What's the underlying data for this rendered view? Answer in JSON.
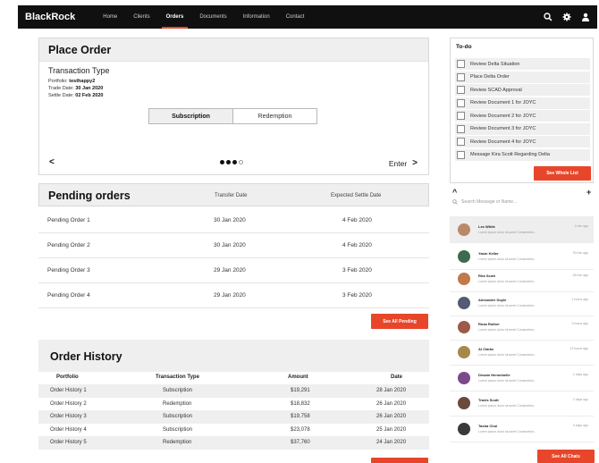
{
  "nav": {
    "brand": "BlackRock",
    "items": [
      {
        "label": "Home",
        "active": false
      },
      {
        "label": "Clients",
        "active": false
      },
      {
        "label": "Orders",
        "active": true
      },
      {
        "label": "Documents",
        "active": false
      },
      {
        "label": "Information",
        "active": false
      },
      {
        "label": "Contact",
        "active": false
      }
    ],
    "icons": [
      "search-icon",
      "gear-icon",
      "user-icon"
    ]
  },
  "place_order": {
    "title": "Place Order",
    "transaction_type_label": "Transaction Type",
    "portfolio_label": "Portfolio:",
    "portfolio_value": "testhappy2",
    "trade_date_label": "Trade Date:",
    "trade_date_value": "30 Jan 2020",
    "settle_date_label": "Settle Date:",
    "settle_date_value": "02 Feb 2020",
    "options": [
      "Subscription",
      "Redemption"
    ],
    "selected_option": "Subscription",
    "prev_label": "<",
    "enter_label": "Enter",
    "enter_chevron": ">",
    "step_dots": [
      true,
      true,
      true,
      false
    ]
  },
  "pending": {
    "title": "Pending orders",
    "col_transfer": "Transfer Date",
    "col_settle": "Expected Settle Date",
    "rows": [
      {
        "name": "Pending Order 1",
        "transfer": "30 Jan 2020",
        "settle": "4 Feb 2020"
      },
      {
        "name": "Pending Order 2",
        "transfer": "30 Jan 2020",
        "settle": "4 Feb 2020"
      },
      {
        "name": "Pending Order 3",
        "transfer": "29 Jan 2020",
        "settle": "3 Feb 2020"
      },
      {
        "name": "Pending Order 4",
        "transfer": "29 Jan 2020",
        "settle": "3 Feb 2020"
      }
    ],
    "see_all_label": "See All Pending"
  },
  "history": {
    "title": "Order History",
    "columns": [
      "Portfolio",
      "Transaction Type",
      "Amount",
      "Date"
    ],
    "rows": [
      {
        "portfolio": "Order History 1",
        "type": "Subscription",
        "amount": "$19,291",
        "date": "28 Jan 2020"
      },
      {
        "portfolio": "Order History 2",
        "type": "Redemption",
        "amount": "$18,832",
        "date": "26 Jan 2020"
      },
      {
        "portfolio": "Order History 3",
        "type": "Subscription",
        "amount": "$19,758",
        "date": "26 Jan 2020"
      },
      {
        "portfolio": "Order History 4",
        "type": "Subscription",
        "amount": "$23,078",
        "date": "25 Jan 2020"
      },
      {
        "portfolio": "Order History 5",
        "type": "Redemption",
        "amount": "$37,760",
        "date": "24 Jan 2020"
      }
    ]
  },
  "todo": {
    "title": "To-do",
    "items": [
      "Review Delta Situation",
      "Place Delta Order",
      "Review SCAD Approval",
      "Review Document 1 for JOYC",
      "Review Document 2 for JOYC",
      "Review Document 3 for JOYC",
      "Review Document 4 for JOYC",
      "Message Kira Scott Regarding Delta"
    ],
    "see_whole_label": "See Whole List"
  },
  "chats": {
    "collapse_glyph": "^",
    "add_glyph": "+",
    "search_placeholder": "Search Message or Name...",
    "items": [
      {
        "name": "Lex White",
        "msg": "Lorem ipsum dolor sit amet Consectetur...",
        "time": "2 min ago",
        "color": "#b98a6a"
      },
      {
        "name": "Yasin Keller",
        "msg": "Lorem ipsum dolor sit amet Consectetur...",
        "time": "30 min ago",
        "color": "#3d6b4e"
      },
      {
        "name": "Rira Scott",
        "msg": "Lorem ipsum dolor sit amet Consectetur...",
        "time": "46 min ago",
        "color": "#c07a4c"
      },
      {
        "name": "Alexander Doyle",
        "msg": "Lorem ipsum dolor sit amet Consectetur...",
        "time": "1 hours ago",
        "color": "#555a70"
      },
      {
        "name": "Rosa Rother",
        "msg": "Lorem ipsum dolor sit amet Consectetur...",
        "time": "3 hours ago",
        "color": "#9c5a4a"
      },
      {
        "name": "Al Clarke",
        "msg": "Lorem ipsum dolor sit amet Consectetur...",
        "time": "12 hours ago",
        "color": "#a8884a"
      },
      {
        "name": "Desain Hennebelle",
        "msg": "Lorem ipsum dolor sit amet Consectetur...",
        "time": "1 days ago",
        "color": "#7a4a8a"
      },
      {
        "name": "Travis Scott",
        "msg": "Lorem ipsum dolor sit amet Consectetur...",
        "time": "2 days ago",
        "color": "#6a4a3a"
      },
      {
        "name": "Tasha Choi",
        "msg": "Lorem ipsum dolor sit amet Consectetur...",
        "time": "3 days ago",
        "color": "#3a3a3a"
      }
    ],
    "see_all_label": "See All Chats"
  },
  "colors": {
    "accent": "#e8462a",
    "nav_bg": "#101010",
    "panel_header": "#efefef"
  }
}
